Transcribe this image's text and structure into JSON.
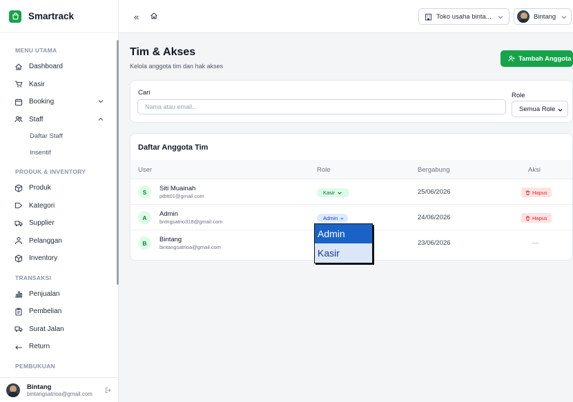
{
  "brand": {
    "name": "Smartrack",
    "color": "#16a34a"
  },
  "sidebar": {
    "section_main": "MENU UTAMA",
    "dashboard": "Dashboard",
    "kasir": "Kasir",
    "booking": "Booking",
    "staff": "Staff",
    "staff_sub": {
      "daftar_staff": "Daftar Staff",
      "insentif": "Insentif"
    },
    "section_produk": "PRODUK & INVENTORY",
    "produk": "Produk",
    "kategori": "Kategori",
    "supplier": "Supplier",
    "pelanggan": "Pelanggan",
    "inventory": "Inventory",
    "section_transaksi": "TRANSAKSI",
    "penjualan": "Penjualan",
    "pembelian": "Pembelian",
    "surat_jalan": "Surat Jalan",
    "return": "Return",
    "section_partial": "PEMBUKUAN",
    "user": {
      "name": "Bintang",
      "email": "bintangsatrioa@gmail.com"
    }
  },
  "topbar": {
    "store_label": "Toko usaha binta...",
    "user_label": "Bintang"
  },
  "page": {
    "title": "Tim & Akses",
    "subtitle": "Kelola anggota tim dan hak akses",
    "add_button": "Tambah Anggota"
  },
  "filter": {
    "search_label": "Cari",
    "search_placeholder": "Nama atau email...",
    "role_label": "Role",
    "role_value": "Semua Role"
  },
  "team": {
    "title": "Daftar Anggota Tim",
    "columns": {
      "user": "User",
      "role": "Role",
      "joined": "Bergabung",
      "action": "Aksi"
    },
    "rows": [
      {
        "initial": "S",
        "name": "Siti Muainah",
        "email": "ptbtt01@gmail.com",
        "role": "Kasir",
        "joined": "25/06/2026",
        "action": "Hapus"
      },
      {
        "initial": "A",
        "name": "Admin",
        "email": "bntngsatrio318@gmail.com",
        "role": "Admin",
        "joined": "24/06/2026",
        "action": "Hapus"
      },
      {
        "initial": "B",
        "name": "Bintang",
        "email": "bintangsatrioa@gmail.com",
        "role": "",
        "joined": "23/06/2026",
        "action": "—"
      }
    ]
  },
  "role_dropdown": {
    "options": [
      "Admin",
      "Kasir"
    ],
    "selected": "Admin"
  }
}
